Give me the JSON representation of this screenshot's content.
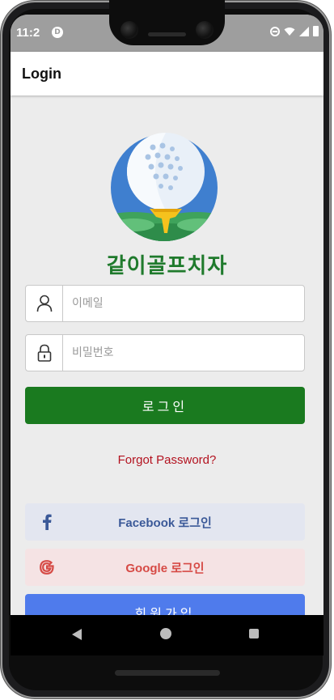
{
  "status_bar": {
    "time": "11:2",
    "notif_glyph": "D"
  },
  "app_bar": {
    "title": "Login"
  },
  "brand": {
    "name": "같이골프치자",
    "color": "#1f7a2c"
  },
  "form": {
    "email_placeholder": "이메일",
    "password_placeholder": "비밀번호",
    "email_value": "",
    "password_value": ""
  },
  "buttons": {
    "login_label": "로그인",
    "forgot_label": "Forgot Password?",
    "facebook_label": "Facebook 로그인",
    "google_label": "Google 로그인",
    "signup_label": "회원가입"
  },
  "icons": {
    "email_field_icon": "person-icon",
    "password_field_icon": "lock-icon",
    "facebook_icon": "facebook-icon",
    "google_icon": "google-icon"
  },
  "colors": {
    "login_button": "#1a7a1f",
    "forgot_text": "#b3121f",
    "facebook_bg": "#e3e6f0",
    "facebook_text": "#3b5998",
    "google_bg": "#f5e3e4",
    "google_text": "#d64a45",
    "signup_button": "#4f7bec"
  }
}
